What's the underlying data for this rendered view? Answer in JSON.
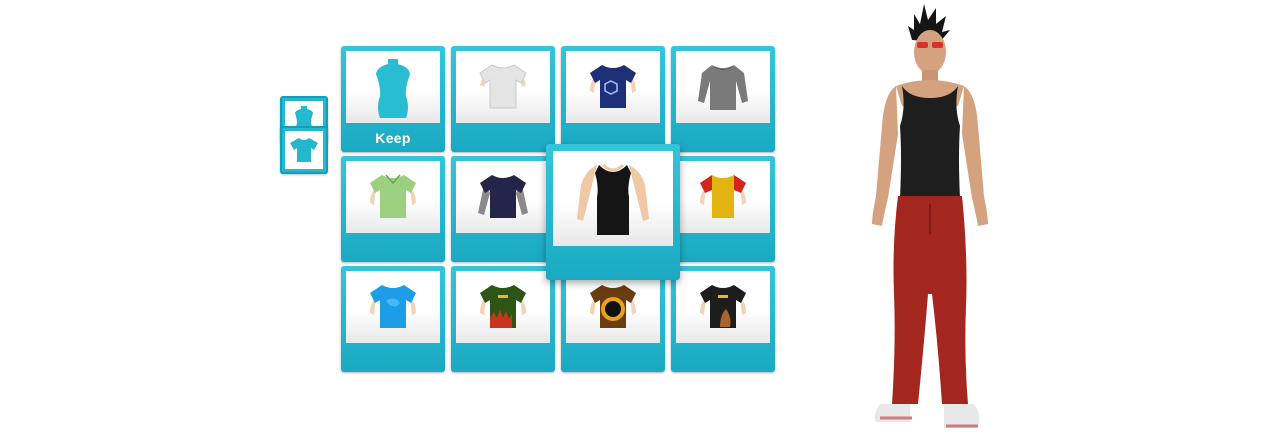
{
  "categories": [
    {
      "id": "outfit",
      "icon": "mannequin-icon",
      "color": "#24b8cf"
    },
    {
      "id": "shirts",
      "icon": "tshirt-icon",
      "color": "#24b8cf"
    }
  ],
  "grid": {
    "accent_color": "#24b8cf",
    "keep_label": "Keep",
    "selected_item": "black-tank-top",
    "items": [
      {
        "name": "keep",
        "label": "Keep"
      },
      {
        "name": "white-tshirt"
      },
      {
        "name": "navy-logo-tshirt"
      },
      {
        "name": "grey-longsleeve"
      },
      {
        "name": "green-polo"
      },
      {
        "name": "navy-layered-longsleeve"
      },
      {
        "name": "black-tank-top"
      },
      {
        "name": "yellow-red-raglan"
      },
      {
        "name": "blue-print-tshirt"
      },
      {
        "name": "green-flame-tshirt"
      },
      {
        "name": "brown-eclipse-tshirt"
      },
      {
        "name": "black-graphic-tshirt"
      }
    ]
  },
  "avatar": {
    "top_color": "#1e1e1e",
    "pants_color": "#a3261f",
    "shoes_color": "#e8e8e8"
  }
}
